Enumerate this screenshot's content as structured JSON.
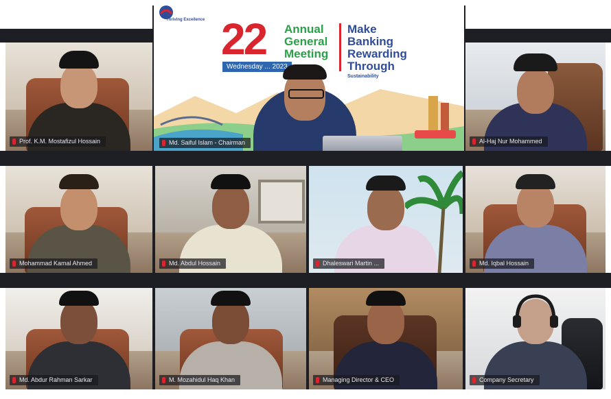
{
  "banner": {
    "logo_text": "Thriving Excellence",
    "anniversary_number": "22",
    "agm_line1": "Annual",
    "agm_line2": "General",
    "agm_line3": "Meeting",
    "date_text": "Wednesday ... 2023",
    "slogan_line1": "Make",
    "slogan_line2": "Banking",
    "slogan_line3": "Rewarding",
    "slogan_line4": "Through",
    "slogan_sub": "Sustainability"
  },
  "participants": [
    {
      "name": "Prof. K.M. Mostafizul Hossain"
    },
    {
      "name": "Md. Saiful Islam - Chairman"
    },
    {
      "name": "Al-Haj Nur Mohammed"
    },
    {
      "name": "Mohammad Kamal Ahmed"
    },
    {
      "name": "Md. Abdul Hossain"
    },
    {
      "name": "Dhaleswari Martin ..."
    },
    {
      "name": "Md. Iqbal Hossain"
    },
    {
      "name": "Md. Abdur Rahman Sarkar"
    },
    {
      "name": "M. Mozahidul Haq Khan"
    },
    {
      "name": "Managing Director & CEO"
    },
    {
      "name": "Company Secretary"
    }
  ],
  "colors": {
    "bar": "#1e1f24",
    "brand_red": "#d9262e",
    "brand_green": "#2aa048",
    "brand_blue": "#2f4d9a",
    "mic_indicator": "#d9262e"
  }
}
